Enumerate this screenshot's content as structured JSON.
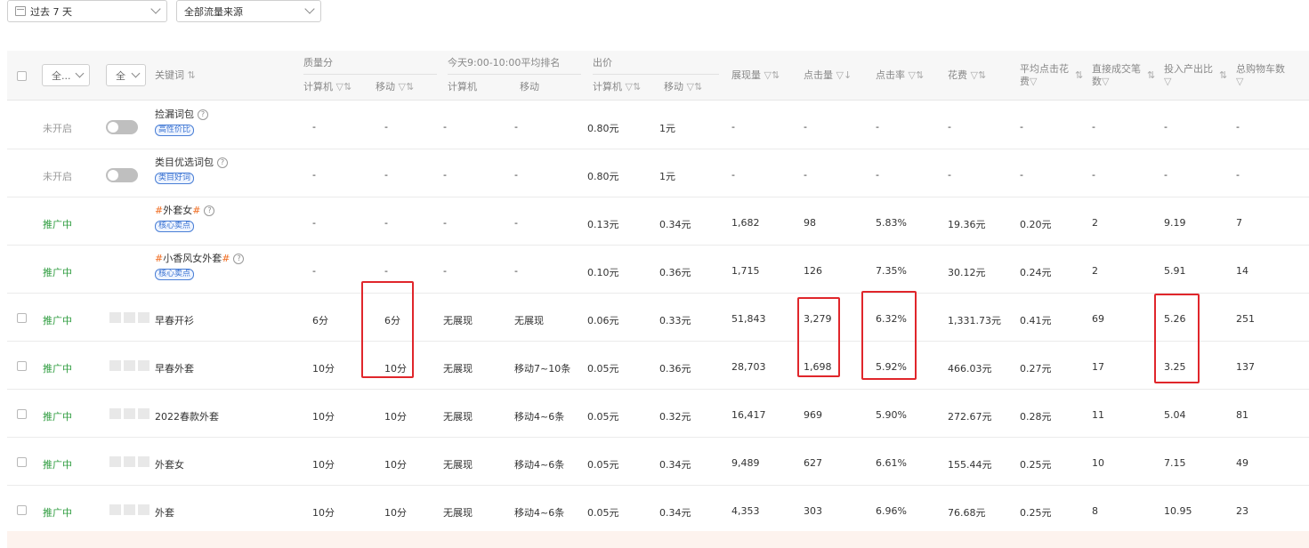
{
  "filters": {
    "date_range": "过去 7 天",
    "traffic_source": "全部流量来源"
  },
  "header": {
    "select1": "全...",
    "select2": "全",
    "keyword": "关键词",
    "quality": "质量分",
    "today_rank": "今天9:00-10:00平均排名",
    "bid": "出价",
    "pc": "计算机",
    "mobile": "移动",
    "impressions": "展现量",
    "clicks": "点击量",
    "ctr": "点击率",
    "cost": "花费",
    "avg_cpc_1": "平均点击花",
    "avg_cpc_2": "费",
    "direct_deals_1": "直接成交笔",
    "direct_deals_2": "数",
    "roi_1": "投入产出比",
    "cart_1": "总购物车数"
  },
  "rows": [
    {
      "status": "未开启",
      "keyword": "捡漏词包",
      "badge": "高性价比",
      "q_pc": "-",
      "q_mobile": "-",
      "rank_pc": "-",
      "rank_mobile": "-",
      "bid_pc": "0.80元",
      "bid_mobile": "1元",
      "impr": "-",
      "clicks": "-",
      "ctr": "-",
      "cost": "-",
      "cpc": "-",
      "deals": "-",
      "roi": "-",
      "cart": "-"
    },
    {
      "status": "未开启",
      "keyword": "类目优选词包",
      "badge": "类目好词",
      "q_pc": "-",
      "q_mobile": "-",
      "rank_pc": "-",
      "rank_mobile": "-",
      "bid_pc": "0.80元",
      "bid_mobile": "1元",
      "impr": "-",
      "clicks": "-",
      "ctr": "-",
      "cost": "-",
      "cpc": "-",
      "deals": "-",
      "roi": "-",
      "cart": "-"
    },
    {
      "status": "推广中",
      "keyword": "外套女",
      "badge": "核心卖点",
      "q_pc": "-",
      "q_mobile": "-",
      "rank_pc": "-",
      "rank_mobile": "-",
      "bid_pc": "0.13元",
      "bid_mobile": "0.34元",
      "impr": "1,682",
      "clicks": "98",
      "ctr": "5.83%",
      "cost": "19.36元",
      "cpc": "0.20元",
      "deals": "2",
      "roi": "9.19",
      "cart": "7"
    },
    {
      "status": "推广中",
      "keyword": "小香风女外套",
      "badge": "核心卖点",
      "q_pc": "-",
      "q_mobile": "-",
      "rank_pc": "-",
      "rank_mobile": "-",
      "bid_pc": "0.10元",
      "bid_mobile": "0.36元",
      "impr": "1,715",
      "clicks": "126",
      "ctr": "7.35%",
      "cost": "30.12元",
      "cpc": "0.24元",
      "deals": "2",
      "roi": "5.91",
      "cart": "14"
    },
    {
      "status": "推广中",
      "keyword": "早春开衫",
      "q_pc": "6分",
      "q_mobile": "6分",
      "rank_pc": "无展现",
      "rank_mobile": "无展现",
      "bid_pc": "0.06元",
      "bid_mobile": "0.33元",
      "impr": "51,843",
      "clicks": "3,279",
      "ctr": "6.32%",
      "cost": "1,331.73元",
      "cpc": "0.41元",
      "deals": "69",
      "roi": "5.26",
      "cart": "251"
    },
    {
      "status": "推广中",
      "keyword": "早春外套",
      "q_pc": "10分",
      "q_mobile": "10分",
      "rank_pc": "无展现",
      "rank_mobile": "移动7~10条",
      "bid_pc": "0.05元",
      "bid_mobile": "0.36元",
      "impr": "28,703",
      "clicks": "1,698",
      "ctr": "5.92%",
      "cost": "466.03元",
      "cpc": "0.27元",
      "deals": "17",
      "roi": "3.25",
      "cart": "137"
    },
    {
      "status": "推广中",
      "keyword": "2022春款外套",
      "q_pc": "10分",
      "q_mobile": "10分",
      "rank_pc": "无展现",
      "rank_mobile": "移动4~6条",
      "bid_pc": "0.05元",
      "bid_mobile": "0.32元",
      "impr": "16,417",
      "clicks": "969",
      "ctr": "5.90%",
      "cost": "272.67元",
      "cpc": "0.28元",
      "deals": "11",
      "roi": "5.04",
      "cart": "81"
    },
    {
      "status": "推广中",
      "keyword": "外套女",
      "q_pc": "10分",
      "q_mobile": "10分",
      "rank_pc": "无展现",
      "rank_mobile": "移动4~6条",
      "bid_pc": "0.05元",
      "bid_mobile": "0.34元",
      "impr": "9,489",
      "clicks": "627",
      "ctr": "6.61%",
      "cost": "155.44元",
      "cpc": "0.25元",
      "deals": "10",
      "roi": "7.15",
      "cart": "49"
    },
    {
      "status": "推广中",
      "keyword": "外套",
      "q_pc": "10分",
      "q_mobile": "10分",
      "rank_pc": "无展现",
      "rank_mobile": "移动4~6条",
      "bid_pc": "0.05元",
      "bid_mobile": "0.34元",
      "impr": "4,353",
      "clicks": "303",
      "ctr": "6.96%",
      "cost": "76.68元",
      "cpc": "0.25元",
      "deals": "8",
      "roi": "10.95",
      "cart": "23"
    }
  ]
}
